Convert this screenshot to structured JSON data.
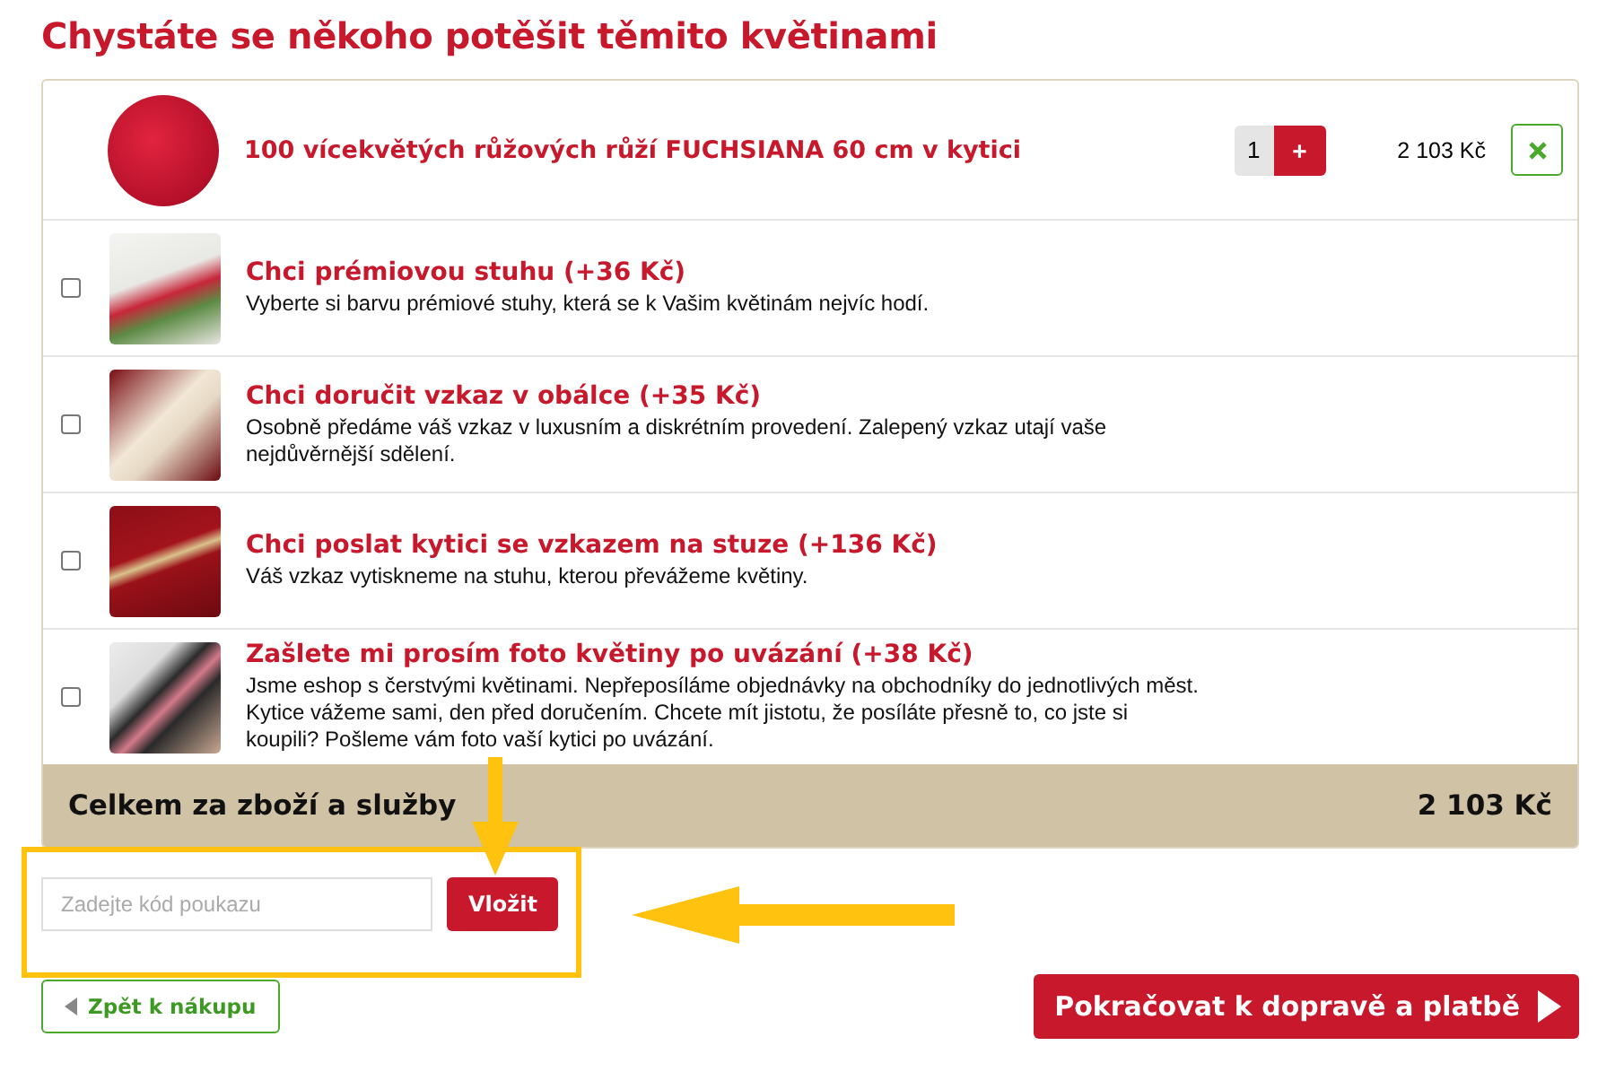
{
  "title": "Chystáte se někoho potěšit těmito květinami",
  "product": {
    "name": "100 vícekvětých růžových růží FUCHSIANA 60 cm v kytici",
    "quantity": "1",
    "plus": "+",
    "price": "2 103 Kč"
  },
  "options": [
    {
      "title": "Chci prémiovou stuhu (+36 Kč)",
      "description": "Vyberte si barvu prémiové stuhy, která se k Vašim květinám nejvíc hodí.",
      "checked": false
    },
    {
      "title": "Chci doručit vzkaz v obálce (+35 Kč)",
      "description": "Osobně předáme váš vzkaz v luxusním a diskrétním provedení. Zalepený vzkaz utají vaše nejdůvěrnější sdělení.",
      "checked": false
    },
    {
      "title": "Chci poslat kytici se vzkazem na stuze (+136 Kč)",
      "description": "Váš vzkaz vytiskneme na stuhu, kterou převážeme květiny.",
      "checked": false
    },
    {
      "title": "Zašlete mi prosím foto květiny po uvázání (+38 Kč)",
      "description": "Jsme eshop s čerstvými květinami. Nepřeposíláme objednávky na obchodníky do jednotlivých měst. Kytice vážeme sami, den před doručením. Chcete mít jistotu, že posíláte přesně to, co jste si koupili? Pošleme vám foto vaší kytici po uvázání.",
      "checked": false
    }
  ],
  "total": {
    "label": "Celkem za zboží a služby",
    "value": "2 103 Kč"
  },
  "coupon": {
    "placeholder": "Zadejte kód poukazu",
    "button": "Vložit"
  },
  "back_button": "Zpět k nákupu",
  "continue_button": "Pokračovat k dopravě a platbě"
}
